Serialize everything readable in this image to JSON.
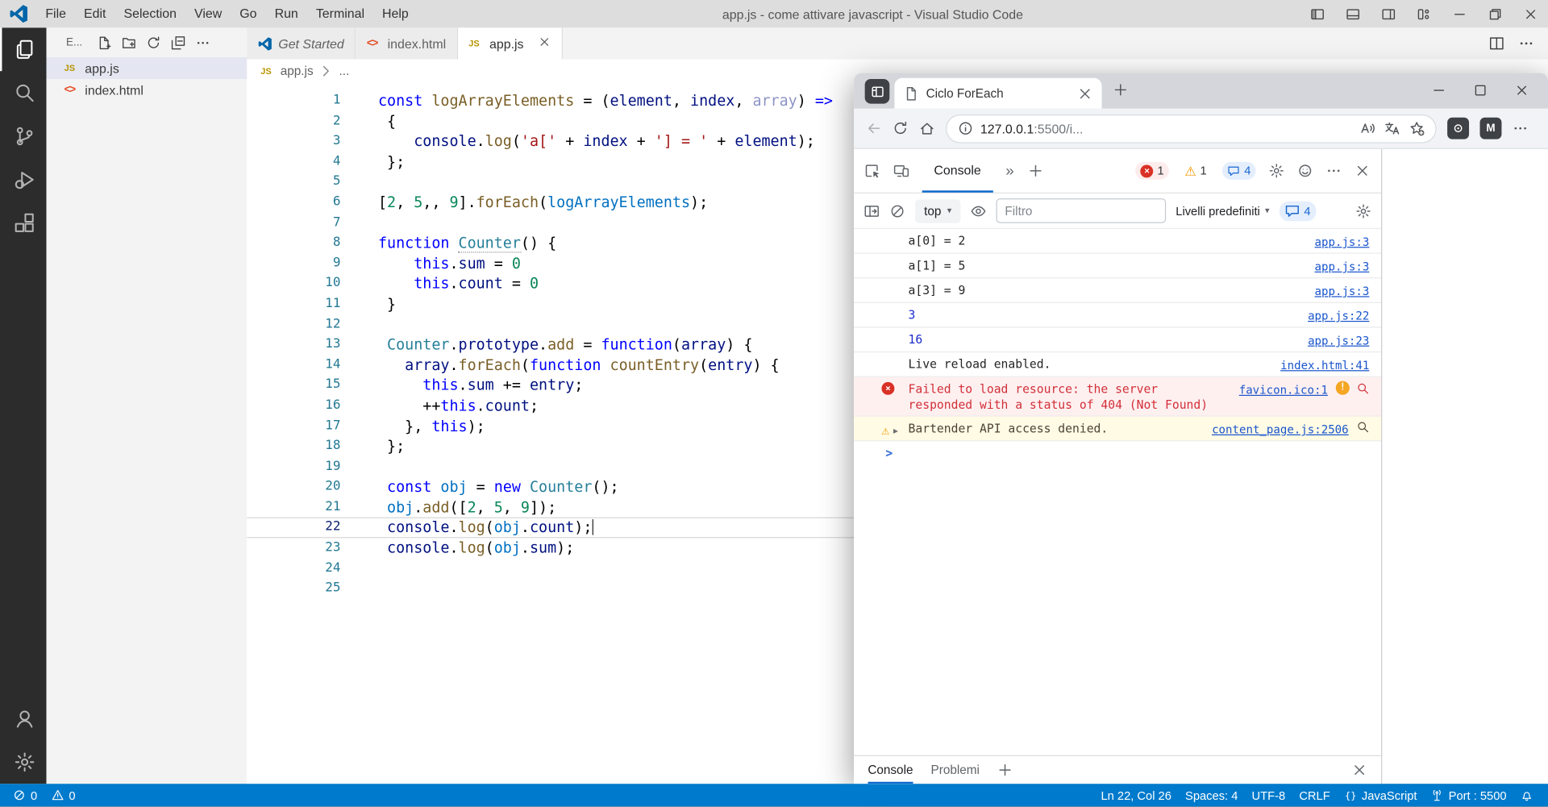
{
  "colors": {
    "vscode_statusbar": "#007acc",
    "vscode_activitybar": "#2c2c2c",
    "selection_bg": "#e4e6f1",
    "devtools_accent": "#0b68cb",
    "error_red": "#d93025",
    "warning_amber": "#f29900",
    "link_blue": "#1a56cc",
    "error_row_bg": "#fff0f0",
    "warning_row_bg": "#fffbe5"
  },
  "vscode": {
    "title": "app.js - come attivare javascript - Visual Studio Code",
    "menus": [
      "File",
      "Edit",
      "Selection",
      "View",
      "Go",
      "Run",
      "Terminal",
      "Help"
    ],
    "activity_bar": {
      "top": [
        {
          "icon": "files",
          "name": "explorer",
          "active": true
        },
        {
          "icon": "search",
          "name": "search",
          "active": false
        },
        {
          "icon": "source-control",
          "name": "source-control",
          "active": false
        },
        {
          "icon": "debug",
          "name": "run-and-debug",
          "active": false
        },
        {
          "icon": "extensions",
          "name": "extensions",
          "active": false
        }
      ],
      "bottom": [
        {
          "icon": "account",
          "name": "account"
        },
        {
          "icon": "gear",
          "name": "settings"
        }
      ]
    },
    "explorer": {
      "header": "E...",
      "actions": [
        "new-file",
        "new-folder",
        "refresh",
        "collapse-all",
        "ellipsis"
      ],
      "files": [
        {
          "label": "app.js",
          "icon": "js",
          "selected": true
        },
        {
          "label": "index.html",
          "icon": "html",
          "selected": false
        }
      ]
    },
    "tabs": [
      {
        "label": "Get Started",
        "icon": "vscode-logo",
        "preview": true,
        "active": false
      },
      {
        "label": "index.html",
        "icon": "html",
        "preview": false,
        "active": false
      },
      {
        "label": "app.js",
        "icon": "js",
        "preview": false,
        "active": true
      }
    ],
    "breadcrumb": {
      "file": "app.js",
      "more": "..."
    },
    "editor": {
      "active_line": 22,
      "lines": [
        [
          [
            "k",
            "const"
          ],
          [
            "p",
            " "
          ],
          [
            "f",
            "logArrayElements"
          ],
          [
            "p",
            " = ("
          ],
          [
            "v",
            "element"
          ],
          [
            "p",
            ", "
          ],
          [
            "v",
            "index"
          ],
          [
            "p",
            ", "
          ],
          [
            "d",
            "array"
          ],
          [
            "p",
            ") "
          ],
          [
            "k",
            "=>"
          ]
        ],
        [
          [
            "p",
            " {"
          ]
        ],
        [
          [
            "p",
            "    "
          ],
          [
            "v",
            "console"
          ],
          [
            "p",
            "."
          ],
          [
            "f",
            "log"
          ],
          [
            "p",
            "("
          ],
          [
            "s",
            "'a['"
          ],
          [
            "p",
            " + "
          ],
          [
            "v",
            "index"
          ],
          [
            "p",
            " + "
          ],
          [
            "s",
            "'] = '"
          ],
          [
            "p",
            " + "
          ],
          [
            "v",
            "element"
          ],
          [
            "p",
            ");"
          ]
        ],
        [
          [
            "p",
            " };"
          ]
        ],
        [],
        [
          [
            "p",
            "["
          ],
          [
            "n",
            "2"
          ],
          [
            "p",
            ", "
          ],
          [
            "n",
            "5"
          ],
          [
            "p",
            ",, "
          ],
          [
            "n",
            "9"
          ],
          [
            "p",
            "]."
          ],
          [
            "f",
            "forEach"
          ],
          [
            "p",
            "("
          ],
          [
            "o",
            "logArrayElements"
          ],
          [
            "p",
            ");"
          ]
        ],
        [],
        [
          [
            "k",
            "function"
          ],
          [
            "p",
            " "
          ],
          [
            "ch",
            "Counter"
          ],
          [
            "p",
            "() {"
          ]
        ],
        [
          [
            "p",
            "    "
          ],
          [
            "k",
            "this"
          ],
          [
            "p",
            "."
          ],
          [
            "v",
            "sum"
          ],
          [
            "p",
            " = "
          ],
          [
            "n",
            "0"
          ]
        ],
        [
          [
            "p",
            "    "
          ],
          [
            "k",
            "this"
          ],
          [
            "p",
            "."
          ],
          [
            "v",
            "count"
          ],
          [
            "p",
            " = "
          ],
          [
            "n",
            "0"
          ]
        ],
        [
          [
            "p",
            " }"
          ]
        ],
        [],
        [
          [
            "p",
            " "
          ],
          [
            "c",
            "Counter"
          ],
          [
            "p",
            "."
          ],
          [
            "v",
            "prototype"
          ],
          [
            "p",
            "."
          ],
          [
            "f",
            "add"
          ],
          [
            "p",
            " = "
          ],
          [
            "k",
            "function"
          ],
          [
            "p",
            "("
          ],
          [
            "v",
            "array"
          ],
          [
            "p",
            ") {"
          ]
        ],
        [
          [
            "p",
            "   "
          ],
          [
            "v",
            "array"
          ],
          [
            "p",
            "."
          ],
          [
            "f",
            "forEach"
          ],
          [
            "p",
            "("
          ],
          [
            "k",
            "function"
          ],
          [
            "p",
            " "
          ],
          [
            "f",
            "countEntry"
          ],
          [
            "p",
            "("
          ],
          [
            "v",
            "entry"
          ],
          [
            "p",
            ") {"
          ]
        ],
        [
          [
            "p",
            "     "
          ],
          [
            "k",
            "this"
          ],
          [
            "p",
            "."
          ],
          [
            "v",
            "sum"
          ],
          [
            "p",
            " += "
          ],
          [
            "v",
            "entry"
          ],
          [
            "p",
            ";"
          ]
        ],
        [
          [
            "p",
            "     ++"
          ],
          [
            "k",
            "this"
          ],
          [
            "p",
            "."
          ],
          [
            "v",
            "count"
          ],
          [
            "p",
            ";"
          ]
        ],
        [
          [
            "p",
            "   }, "
          ],
          [
            "k",
            "this"
          ],
          [
            "p",
            ");"
          ]
        ],
        [
          [
            "p",
            " };"
          ]
        ],
        [],
        [
          [
            "p",
            " "
          ],
          [
            "k",
            "const"
          ],
          [
            "p",
            " "
          ],
          [
            "o",
            "obj"
          ],
          [
            "p",
            " = "
          ],
          [
            "k",
            "new"
          ],
          [
            "p",
            " "
          ],
          [
            "c",
            "Counter"
          ],
          [
            "p",
            "();"
          ]
        ],
        [
          [
            "p",
            " "
          ],
          [
            "o",
            "obj"
          ],
          [
            "p",
            "."
          ],
          [
            "f",
            "add"
          ],
          [
            "p",
            "(["
          ],
          [
            "n",
            "2"
          ],
          [
            "p",
            ", "
          ],
          [
            "n",
            "5"
          ],
          [
            "p",
            ", "
          ],
          [
            "n",
            "9"
          ],
          [
            "p",
            "]);"
          ]
        ],
        [
          [
            "p",
            " "
          ],
          [
            "v",
            "console"
          ],
          [
            "p",
            "."
          ],
          [
            "f",
            "log"
          ],
          [
            "p",
            "("
          ],
          [
            "o",
            "obj"
          ],
          [
            "p",
            "."
          ],
          [
            "v",
            "count"
          ],
          [
            "p",
            ");"
          ]
        ],
        [
          [
            "p",
            " "
          ],
          [
            "v",
            "console"
          ],
          [
            "p",
            "."
          ],
          [
            "f",
            "log"
          ],
          [
            "p",
            "("
          ],
          [
            "o",
            "obj"
          ],
          [
            "p",
            "."
          ],
          [
            "v",
            "sum"
          ],
          [
            "p",
            ");"
          ]
        ],
        [],
        []
      ]
    },
    "status_bar": {
      "left": [
        {
          "icon": "circle-slash",
          "label": "0",
          "name": "errors"
        },
        {
          "icon": "warning",
          "label": "0",
          "name": "warnings"
        }
      ],
      "right": [
        {
          "icon": "",
          "label": "Ln 22, Col 26",
          "name": "cursor-position"
        },
        {
          "icon": "",
          "label": "Spaces: 4",
          "name": "indentation"
        },
        {
          "icon": "",
          "label": "UTF-8",
          "name": "encoding"
        },
        {
          "icon": "",
          "label": "CRLF",
          "name": "eol"
        },
        {
          "icon": "braces",
          "label": "JavaScript",
          "name": "language-mode"
        },
        {
          "icon": "tower",
          "label": "Port : 5500",
          "name": "live-server-port"
        },
        {
          "icon": "bell",
          "label": "",
          "name": "notifications"
        }
      ]
    }
  },
  "browser": {
    "tab_title": "Ciclo ForEach",
    "url": {
      "host": "127.0.0.1",
      "rest": ":5500/i..."
    },
    "extensions": [
      "extension",
      "m-extension"
    ],
    "devtools": {
      "active_panel": "Console",
      "top_badges": [
        {
          "type": "error",
          "count": "1"
        },
        {
          "type": "warning",
          "count": "1"
        },
        {
          "type": "message",
          "count": "4"
        }
      ],
      "console_toolbar": {
        "context": "top",
        "filter_placeholder": "Filtro",
        "levels": "Livelli predefiniti",
        "message_count": "4"
      },
      "messages": [
        {
          "type": "log",
          "text": "a[0] = 2",
          "link": "app.js:3"
        },
        {
          "type": "log",
          "text": "a[1] = 5",
          "link": "app.js:3"
        },
        {
          "type": "log",
          "text": "a[3] = 9",
          "link": "app.js:3"
        },
        {
          "type": "number",
          "text": "3",
          "link": "app.js:22"
        },
        {
          "type": "number",
          "text": "16",
          "link": "app.js:23"
        },
        {
          "type": "log",
          "text": "Live reload enabled.",
          "link": "index.html:41"
        },
        {
          "type": "error",
          "text": "Failed to load resource: the server responded with a status of 404 (Not Found)",
          "link": "favicon.ico:1"
        },
        {
          "type": "warning",
          "text": "Bartender API access denied.",
          "link": "content_page.js:2506"
        }
      ],
      "prompt": ">",
      "drawer_tabs": [
        {
          "label": "Console",
          "active": true
        },
        {
          "label": "Problemi",
          "active": false
        }
      ]
    }
  }
}
